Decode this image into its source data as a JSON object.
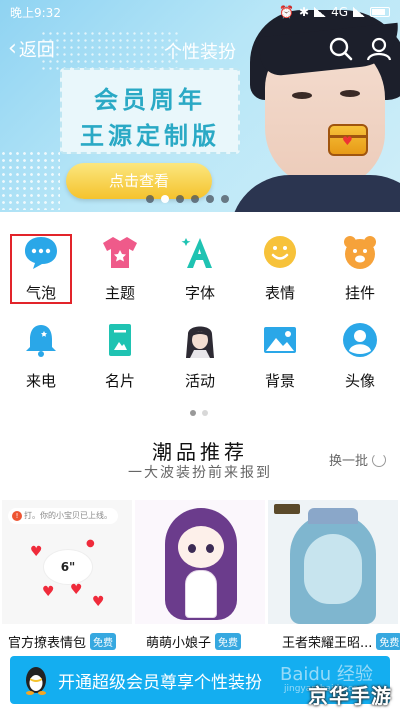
{
  "status_bar": {
    "time": "晚上9:32",
    "network": "4G"
  },
  "nav": {
    "back_label": "返回",
    "title": "个性装扮"
  },
  "banner": {
    "line1": "会员周年",
    "line2": "王源定制版",
    "button": "点击查看",
    "pages": 6,
    "active_page": 1
  },
  "categories": [
    {
      "label": "气泡",
      "icon": "chat-bubble-icon"
    },
    {
      "label": "主题",
      "icon": "tshirt-icon"
    },
    {
      "label": "字体",
      "icon": "font-a-icon"
    },
    {
      "label": "表情",
      "icon": "smiley-icon"
    },
    {
      "label": "挂件",
      "icon": "bear-pendant-icon"
    },
    {
      "label": "来电",
      "icon": "bell-icon"
    },
    {
      "label": "名片",
      "icon": "card-icon"
    },
    {
      "label": "活动",
      "icon": "character-avatar-icon"
    },
    {
      "label": "背景",
      "icon": "landscape-image-icon"
    },
    {
      "label": "头像",
      "icon": "person-head-icon"
    }
  ],
  "trendy": {
    "title": "潮品推荐",
    "subtitle": "一大波装扮前来报到",
    "refresh": "换一批",
    "bubble_preview_text": "打。你的小宝贝已上线。",
    "bubble_preview_number": "6\"",
    "items": [
      {
        "name": "官方撩表情包",
        "badge": "免费"
      },
      {
        "name": "萌萌小娘子",
        "badge": "免费"
      },
      {
        "name": "王者荣耀王昭...",
        "badge": "免费"
      }
    ]
  },
  "vip_bar": {
    "label": "开通超级会员尊享个性装扮"
  },
  "watermark": {
    "text": "京华手游",
    "baidu": "Baidu 经验",
    "baidu_sub": "jingyan.baidu.com"
  },
  "colors": {
    "accent": "#14aef0",
    "highlight": "#e2242a",
    "free_badge": "#36a8e0"
  }
}
